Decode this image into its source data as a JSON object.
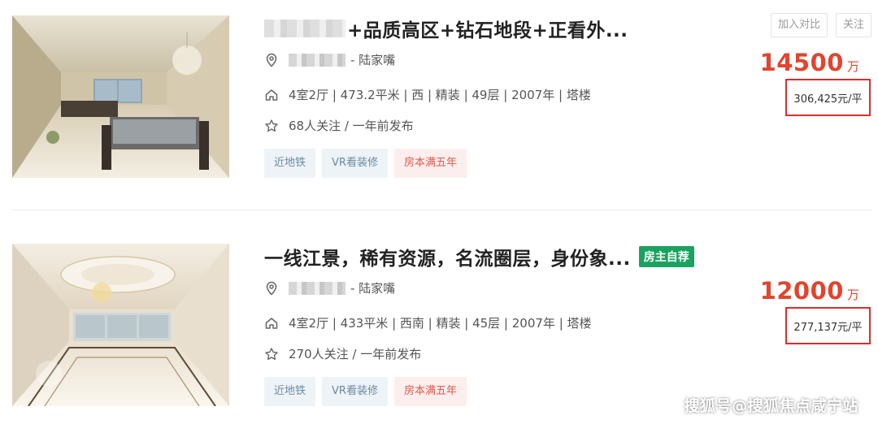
{
  "listings": [
    {
      "title": "+品质高区+钻石地段+正看外...",
      "location": "- 陆家嘴",
      "info": "4室2厅 | 473.2平米 | 西 | 精装 | 49层 | 2007年 | 塔楼",
      "follow": "68人关注 / 一年前发布",
      "tags": [
        "近地铁",
        "VR看装修",
        "房本满五年"
      ],
      "price": "14500",
      "price_unit": "万",
      "unit_price": "306,425元/平",
      "compare_label": "加入对比",
      "follow_label": "关注",
      "icons": {
        "location": "location-pin-icon",
        "house": "house-icon",
        "star": "star-icon"
      }
    },
    {
      "title": "一线江景，稀有资源，名流圈层，身份象...",
      "owner_badge": "房主自荐",
      "location": "- 陆家嘴",
      "info": "4室2厅 | 433平米 | 西南 | 精装 | 45层 | 2007年 | 塔楼",
      "follow": "270人关注 / 一年前发布",
      "tags": [
        "近地铁",
        "VR看装修",
        "房本满五年"
      ],
      "price": "12000",
      "price_unit": "万",
      "unit_price": "277,137元/平",
      "icons": {
        "location": "location-pin-icon",
        "house": "house-icon",
        "star": "star-icon"
      }
    }
  ],
  "watermark": "搜狐号@搜狐焦点咸宁站",
  "colors": {
    "price": "#e0452f",
    "highlight_box": "#e22a2a",
    "owner_badge": "#1aa25f",
    "tag_blue_bg": "#eef3f7",
    "tag_red_bg": "#fdeeee"
  }
}
